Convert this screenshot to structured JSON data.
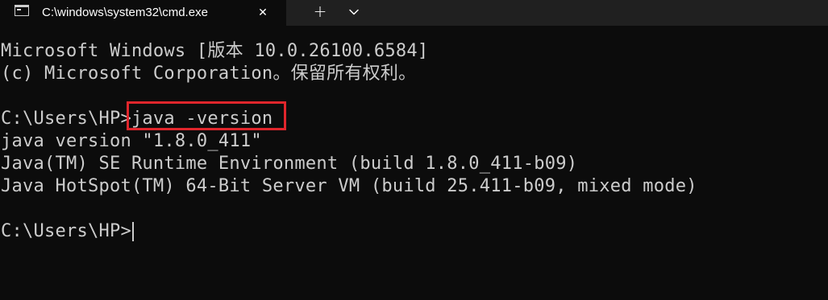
{
  "window": {
    "tab_title": "C:\\windows\\system32\\cmd.exe",
    "tab_close": "✕",
    "new_tab": "+",
    "dropdown_icon": "chevron-down-icon"
  },
  "console": {
    "lines": [
      "Microsoft Windows [版本 10.0.26100.6584]",
      "(c) Microsoft Corporation。保留所有权利。",
      "",
      "C:\\Users\\HP>java -version",
      "java version \"1.8.0_411\"",
      "Java(TM) SE Runtime Environment (build 1.8.0_411-b09)",
      "Java HotSpot(TM) 64-Bit Server VM (build 25.411-b09, mixed mode)",
      "",
      "C:\\Users\\HP>"
    ],
    "highlight_color": "#e0262c",
    "text_color": "#cccccc",
    "background": "#0c0c0c"
  }
}
